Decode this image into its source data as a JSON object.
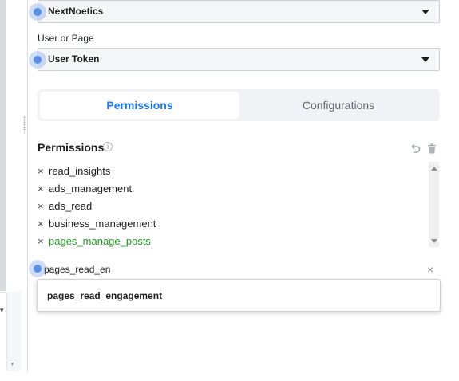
{
  "app_select": {
    "value": "NextNoetics"
  },
  "user_or_page": {
    "label": "User or Page",
    "value": "User Token"
  },
  "tabs": [
    {
      "label": "Permissions",
      "active": true
    },
    {
      "label": "Configurations",
      "active": false
    }
  ],
  "permissions": {
    "title": "Permissions",
    "info_glyph": "i",
    "remove_glyph": "×",
    "items": [
      {
        "name": "read_insights",
        "status": "normal"
      },
      {
        "name": "ads_management",
        "status": "normal"
      },
      {
        "name": "ads_read",
        "status": "normal"
      },
      {
        "name": "business_management",
        "status": "normal"
      },
      {
        "name": "pages_manage_posts",
        "status": "added"
      }
    ]
  },
  "search": {
    "value": "pages_read_en",
    "clear_glyph": "×"
  },
  "suggestions": [
    "pages_read_engagement"
  ],
  "colors": {
    "accent": "#1877f2",
    "added": "#1e9e1e",
    "cursor_dot": "#5b8ee8"
  }
}
